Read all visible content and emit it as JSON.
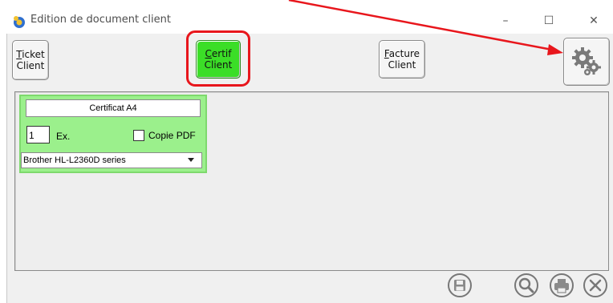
{
  "window": {
    "title": "Edition de document client",
    "minimize_glyph": "–",
    "maximize_glyph": "☐",
    "close_glyph": "✕"
  },
  "toolbar": {
    "ticket": {
      "mnemonic": "T",
      "rest": "icket",
      "line2": "Client"
    },
    "certif": {
      "mnemonic": "C",
      "rest": "ertif",
      "line2": "Client"
    },
    "facture": {
      "mnemonic": "F",
      "rest": "acture",
      "line2": "Client"
    },
    "settings_icon": "gears-icon"
  },
  "document_card": {
    "name": "Certificat A4",
    "copies": "1",
    "copies_label": "Ex.",
    "pdf_label": "Copie PDF",
    "pdf_checked": false,
    "printer": "Brother HL-L2360D series"
  },
  "footer_icons": [
    "save-icon",
    "zoom-icon",
    "print-icon",
    "close-circle-icon"
  ],
  "colors": {
    "active_button": "#3bde27",
    "card_bg": "#9bf08c",
    "highlight": "#e8161c"
  }
}
